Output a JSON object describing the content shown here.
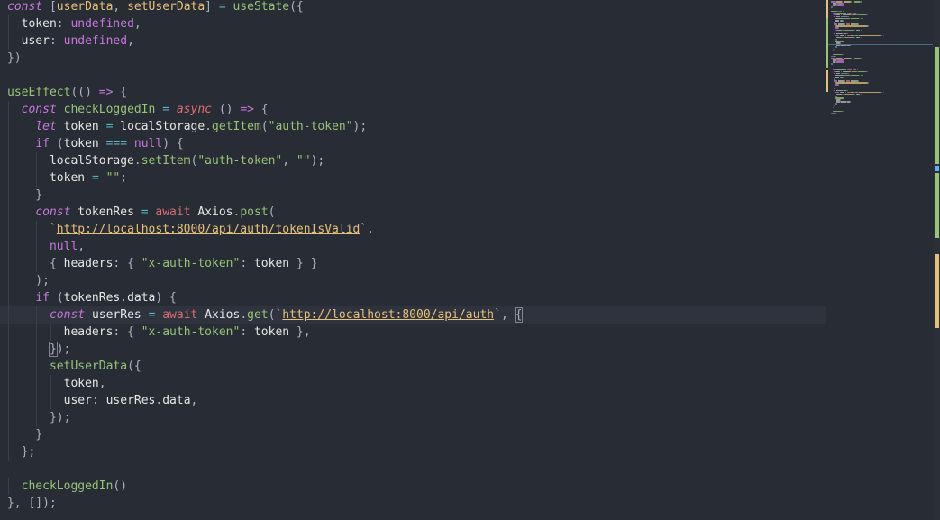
{
  "editor": {
    "colors": {
      "background": "#282c34",
      "keyword": "#c678dd",
      "variable": "#e5c07b",
      "function": "#61afef",
      "string": "#98c379",
      "await": "#e06c75",
      "operator": "#56b6c2",
      "added_marker": "#98c379",
      "modified_marker": "#e5c07b"
    },
    "lines": [
      [
        {
          "t": "const",
          "c": "kw-it"
        },
        {
          "t": " [",
          "c": "punc"
        },
        {
          "t": "userData",
          "c": "var"
        },
        {
          "t": ", ",
          "c": "punc"
        },
        {
          "t": "setUserData",
          "c": "var"
        },
        {
          "t": "] ",
          "c": "punc"
        },
        {
          "t": "=",
          "c": "op"
        },
        {
          "t": " ",
          "c": "punc"
        },
        {
          "t": "useState",
          "c": "fnc"
        },
        {
          "t": "({",
          "c": "punc"
        }
      ],
      [
        {
          "t": "  ",
          "c": "punc"
        },
        {
          "t": "token",
          "c": "prop"
        },
        {
          "t": ": ",
          "c": "punc"
        },
        {
          "t": "undefined",
          "c": "const"
        },
        {
          "t": ",",
          "c": "punc"
        }
      ],
      [
        {
          "t": "  ",
          "c": "punc"
        },
        {
          "t": "user",
          "c": "prop"
        },
        {
          "t": ": ",
          "c": "punc"
        },
        {
          "t": "undefined",
          "c": "const"
        },
        {
          "t": ",",
          "c": "punc"
        }
      ],
      [
        {
          "t": "})",
          "c": "punc"
        }
      ],
      [],
      [
        {
          "t": "useEffect",
          "c": "fnc"
        },
        {
          "t": "(() ",
          "c": "punc"
        },
        {
          "t": "=>",
          "c": "kw"
        },
        {
          "t": " {",
          "c": "punc"
        }
      ],
      [
        {
          "t": "  ",
          "c": "punc"
        },
        {
          "t": "const",
          "c": "kw-it"
        },
        {
          "t": " ",
          "c": "punc"
        },
        {
          "t": "checkLoggedIn",
          "c": "fnc"
        },
        {
          "t": " ",
          "c": "punc"
        },
        {
          "t": "=",
          "c": "op"
        },
        {
          "t": " ",
          "c": "punc"
        },
        {
          "t": "async",
          "c": "async"
        },
        {
          "t": " () ",
          "c": "punc"
        },
        {
          "t": "=>",
          "c": "kw"
        },
        {
          "t": " {",
          "c": "punc"
        }
      ],
      [
        {
          "t": "    ",
          "c": "punc"
        },
        {
          "t": "let",
          "c": "kw-it"
        },
        {
          "t": " ",
          "c": "punc"
        },
        {
          "t": "token",
          "c": "id"
        },
        {
          "t": " ",
          "c": "punc"
        },
        {
          "t": "=",
          "c": "op"
        },
        {
          "t": " ",
          "c": "punc"
        },
        {
          "t": "localStorage",
          "c": "id"
        },
        {
          "t": ".",
          "c": "punc"
        },
        {
          "t": "getItem",
          "c": "fnc"
        },
        {
          "t": "(",
          "c": "punc"
        },
        {
          "t": "\"auth-token\"",
          "c": "str"
        },
        {
          "t": ");",
          "c": "punc"
        }
      ],
      [
        {
          "t": "    ",
          "c": "punc"
        },
        {
          "t": "if",
          "c": "kw"
        },
        {
          "t": " (",
          "c": "punc"
        },
        {
          "t": "token",
          "c": "id"
        },
        {
          "t": " ",
          "c": "punc"
        },
        {
          "t": "===",
          "c": "op"
        },
        {
          "t": " ",
          "c": "punc"
        },
        {
          "t": "null",
          "c": "const"
        },
        {
          "t": ") {",
          "c": "punc"
        }
      ],
      [
        {
          "t": "      ",
          "c": "punc"
        },
        {
          "t": "localStorage",
          "c": "id"
        },
        {
          "t": ".",
          "c": "punc"
        },
        {
          "t": "setItem",
          "c": "fnc"
        },
        {
          "t": "(",
          "c": "punc"
        },
        {
          "t": "\"auth-token\"",
          "c": "str"
        },
        {
          "t": ", ",
          "c": "punc"
        },
        {
          "t": "\"\"",
          "c": "str"
        },
        {
          "t": ");",
          "c": "punc"
        }
      ],
      [
        {
          "t": "      ",
          "c": "punc"
        },
        {
          "t": "token",
          "c": "id"
        },
        {
          "t": " ",
          "c": "punc"
        },
        {
          "t": "=",
          "c": "op"
        },
        {
          "t": " ",
          "c": "punc"
        },
        {
          "t": "\"\"",
          "c": "str"
        },
        {
          "t": ";",
          "c": "punc"
        }
      ],
      [
        {
          "t": "    }",
          "c": "punc"
        }
      ],
      [
        {
          "t": "    ",
          "c": "punc"
        },
        {
          "t": "const",
          "c": "kw-it"
        },
        {
          "t": " ",
          "c": "punc"
        },
        {
          "t": "tokenRes",
          "c": "id"
        },
        {
          "t": " ",
          "c": "punc"
        },
        {
          "t": "=",
          "c": "op"
        },
        {
          "t": " ",
          "c": "punc"
        },
        {
          "t": "await",
          "c": "await"
        },
        {
          "t": " ",
          "c": "punc"
        },
        {
          "t": "Axios",
          "c": "id"
        },
        {
          "t": ".",
          "c": "punc"
        },
        {
          "t": "post",
          "c": "fnc"
        },
        {
          "t": "(",
          "c": "punc"
        }
      ],
      [
        {
          "t": "      `",
          "c": "str"
        },
        {
          "t": "http://localhost:8000/api/auth/tokenIsValid",
          "c": "url"
        },
        {
          "t": "`",
          "c": "str"
        },
        {
          "t": ",",
          "c": "punc"
        }
      ],
      [
        {
          "t": "      ",
          "c": "punc"
        },
        {
          "t": "null",
          "c": "const"
        },
        {
          "t": ",",
          "c": "punc"
        }
      ],
      [
        {
          "t": "      { ",
          "c": "punc"
        },
        {
          "t": "headers",
          "c": "prop"
        },
        {
          "t": ": { ",
          "c": "punc"
        },
        {
          "t": "\"x-auth-token\"",
          "c": "str"
        },
        {
          "t": ": ",
          "c": "punc"
        },
        {
          "t": "token",
          "c": "id"
        },
        {
          "t": " } }",
          "c": "punc"
        }
      ],
      [
        {
          "t": "    );",
          "c": "punc"
        }
      ],
      [
        {
          "t": "    ",
          "c": "punc"
        },
        {
          "t": "if",
          "c": "kw"
        },
        {
          "t": " (",
          "c": "punc"
        },
        {
          "t": "tokenRes",
          "c": "id"
        },
        {
          "t": ".",
          "c": "punc"
        },
        {
          "t": "data",
          "c": "id"
        },
        {
          "t": ") {",
          "c": "punc"
        }
      ],
      [
        {
          "t": "      ",
          "c": "punc"
        },
        {
          "t": "const",
          "c": "kw-it"
        },
        {
          "t": " ",
          "c": "punc"
        },
        {
          "t": "userRes",
          "c": "id"
        },
        {
          "t": " ",
          "c": "punc"
        },
        {
          "t": "=",
          "c": "op"
        },
        {
          "t": " ",
          "c": "punc"
        },
        {
          "t": "await",
          "c": "await"
        },
        {
          "t": " ",
          "c": "punc"
        },
        {
          "t": "Axios",
          "c": "id"
        },
        {
          "t": ".",
          "c": "punc"
        },
        {
          "t": "get",
          "c": "fnc"
        },
        {
          "t": "(`",
          "c": "punc"
        },
        {
          "t": "http://localhost:8000/api/auth",
          "c": "url"
        },
        {
          "t": "`",
          "c": "str"
        },
        {
          "t": ", ",
          "c": "punc"
        },
        {
          "t": "{",
          "c": "bracket"
        }
      ],
      [
        {
          "t": "        ",
          "c": "punc"
        },
        {
          "t": "headers",
          "c": "prop"
        },
        {
          "t": ": { ",
          "c": "punc"
        },
        {
          "t": "\"x-auth-token\"",
          "c": "str"
        },
        {
          "t": ": ",
          "c": "punc"
        },
        {
          "t": "token",
          "c": "id"
        },
        {
          "t": " },",
          "c": "punc"
        }
      ],
      [
        {
          "t": "      ",
          "c": "punc"
        },
        {
          "t": "}",
          "c": "bracket"
        },
        {
          "t": ");",
          "c": "punc"
        }
      ],
      [
        {
          "t": "      ",
          "c": "punc"
        },
        {
          "t": "setUserData",
          "c": "fnc"
        },
        {
          "t": "({",
          "c": "punc"
        }
      ],
      [
        {
          "t": "        ",
          "c": "punc"
        },
        {
          "t": "token",
          "c": "id"
        },
        {
          "t": ",",
          "c": "punc"
        }
      ],
      [
        {
          "t": "        ",
          "c": "punc"
        },
        {
          "t": "user",
          "c": "prop"
        },
        {
          "t": ": ",
          "c": "punc"
        },
        {
          "t": "userRes",
          "c": "id"
        },
        {
          "t": ".",
          "c": "punc"
        },
        {
          "t": "data",
          "c": "id"
        },
        {
          "t": ",",
          "c": "punc"
        }
      ],
      [
        {
          "t": "      });",
          "c": "punc"
        }
      ],
      [
        {
          "t": "    }",
          "c": "punc"
        }
      ],
      [
        {
          "t": "  };",
          "c": "punc"
        }
      ],
      [],
      [
        {
          "t": "  ",
          "c": "punc"
        },
        {
          "t": "checkLoggedIn",
          "c": "fnc"
        },
        {
          "t": "()",
          "c": "punc"
        }
      ],
      [
        {
          "t": "}, []);",
          "c": "punc"
        }
      ]
    ],
    "current_line_index": 18
  }
}
